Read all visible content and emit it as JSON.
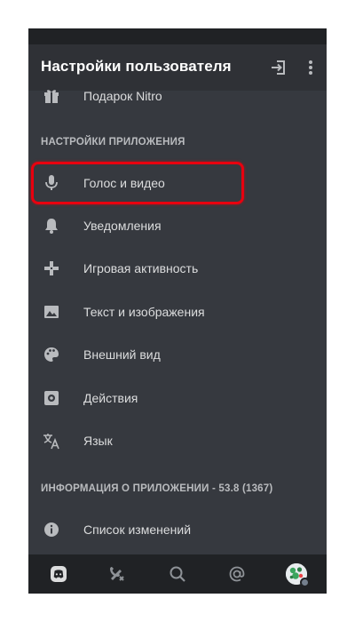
{
  "header": {
    "title": "Настройки пользователя",
    "logout_icon": "logout-icon",
    "more_icon": "more-vertical-icon"
  },
  "items_top": [
    {
      "label": "Подарок Nitro",
      "icon": "gift-icon"
    }
  ],
  "section_app": "НАСТРОЙКИ ПРИЛОЖЕНИЯ",
  "app_items": [
    {
      "label": "Голос и видео",
      "icon": "microphone-icon",
      "highlighted": true
    },
    {
      "label": "Уведомления",
      "icon": "bell-icon"
    },
    {
      "label": "Игровая активность",
      "icon": "gamepad-icon"
    },
    {
      "label": "Текст и изображения",
      "icon": "image-icon"
    },
    {
      "label": "Внешний вид",
      "icon": "palette-icon"
    },
    {
      "label": "Действия",
      "icon": "accessibility-icon"
    },
    {
      "label": "Язык",
      "icon": "translate-icon"
    }
  ],
  "section_info": "ИНФОРМАЦИЯ О ПРИЛОЖЕНИИ - 53.8 (1367)",
  "info_items": [
    {
      "label": "Список изменений",
      "icon": "info-icon"
    }
  ],
  "bottom_nav": [
    {
      "icon": "discord-home-icon",
      "active": true
    },
    {
      "icon": "friends-icon"
    },
    {
      "icon": "search-icon"
    },
    {
      "icon": "mentions-icon"
    },
    {
      "icon": "user-avatar"
    }
  ],
  "colors": {
    "background": "#36393f",
    "header": "#2f3136",
    "bottom_bar": "#202225",
    "text": "#dcddde",
    "section_text": "#b9bbbe",
    "highlight": "#e8000f"
  }
}
